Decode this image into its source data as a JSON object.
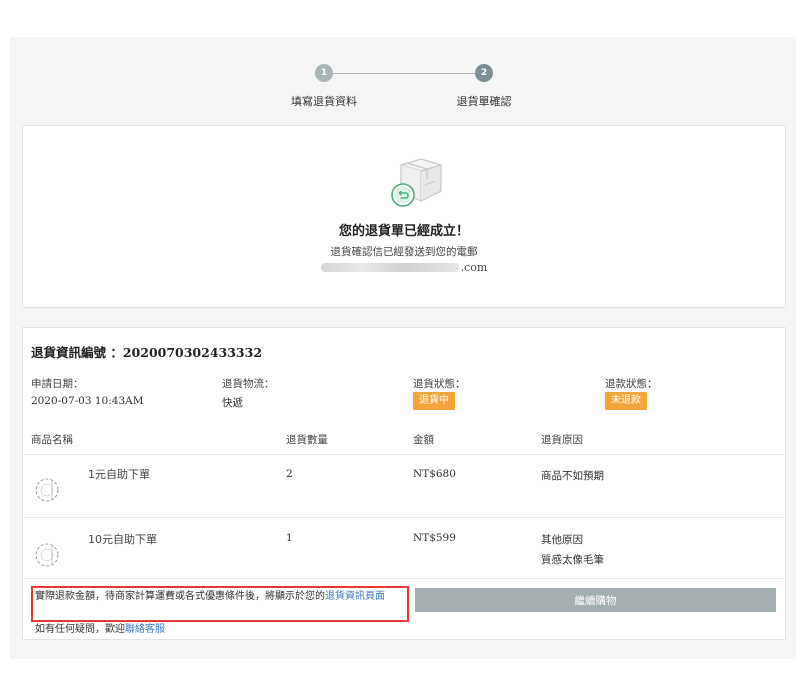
{
  "stepper": {
    "steps": [
      {
        "number": "1",
        "label": "填寫退貨資料"
      },
      {
        "number": "2",
        "label": "退貨單確認"
      }
    ]
  },
  "success": {
    "title": "您的退貨單已經成立！",
    "subtitle": "退貨確認信已經發送到您的電郵",
    "email_suffix": ".com"
  },
  "info": {
    "heading": "退貨資訊編號 ：2020070302433332",
    "apply_date_label": "申請日期：",
    "apply_date_value": "2020-07-03 10:43AM",
    "logistics_label": "退貨物流：",
    "logistics_value": "快遞",
    "return_status_label": "退貨狀態：",
    "return_status_value": "退貨中",
    "refund_status_label": "退款狀態：",
    "refund_status_value": "未退款",
    "status_color": "#f3a43b"
  },
  "table": {
    "headers": [
      "商品名稱",
      "退貨數量",
      "金額",
      "退貨原因"
    ],
    "rows": [
      {
        "name": "1元自助下單",
        "qty": "2",
        "amount": "NT$680",
        "reason": "商品不如預期",
        "reason_detail": ""
      },
      {
        "name": "10元自助下單",
        "qty": "1",
        "amount": "NT$599",
        "reason": "其他原因",
        "reason_detail": "質感太像毛筆"
      }
    ]
  },
  "footer": {
    "note_prefix": "實際退款金額，待商家計算運費或各式優惠條件後，將顯示於您的",
    "note_link": "退貨資訊頁面",
    "help_prefix": "如有任何疑問，歡迎",
    "help_link": "聯絡客服",
    "continue_label": "繼續購物",
    "highlight_color": "#e53935",
    "link_color": "#3c7ac9"
  }
}
